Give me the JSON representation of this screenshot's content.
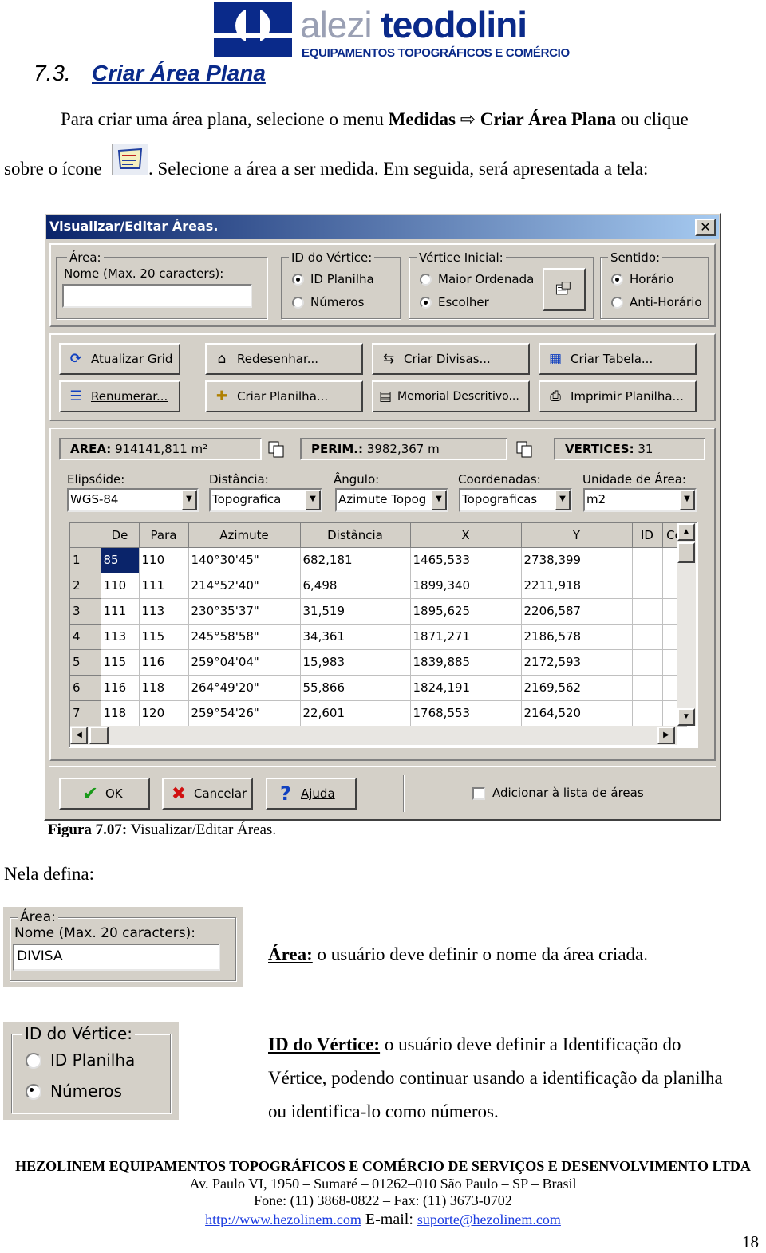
{
  "header": {
    "logo_word1": "alezi",
    "logo_word2": "teodolini",
    "logo_tagline": "EQUIPAMENTOS TOPOGRÁFICOS E COMÉRCIO"
  },
  "section": {
    "number": "7.3.",
    "title": "Criar Área Plana"
  },
  "intro": {
    "p1_a": "Para criar uma área plana, selecione o menu ",
    "p1_menu": "Medidas",
    "p1_arrow": "⇨",
    "p1_item": "Criar Área Plana",
    "p1_b": " ou clique",
    "p2_a": "sobre o ícone",
    "p2_b": ". Selecione a área a ser medida. Em seguida, será apresentada a tela:"
  },
  "dialog": {
    "title": "Visualizar/Editar Áreas.",
    "close": "✕",
    "area_group": {
      "legend": "Área:",
      "label": "Nome (Max. 20 caracters):",
      "value": ""
    },
    "id_group": {
      "legend": "ID do Vértice:",
      "opt1": "ID Planilha",
      "opt2": "Números"
    },
    "vertex_group": {
      "legend": "Vértice Inicial:",
      "opt1": "Maior Ordenada",
      "opt2": "Escolher"
    },
    "dir_group": {
      "legend": "Sentido:",
      "opt1": "Horário",
      "opt2": "Anti-Horário"
    },
    "buttons": {
      "refresh": "Atualizar Grid",
      "redraw": "Redesenhar...",
      "divisions": "Criar Divisas...",
      "table": "Criar Tabela...",
      "renumber": "Renumerar...",
      "sheet": "Criar Planilha...",
      "memorial": "Memorial Descritivo...",
      "print": "Imprimir Planilha..."
    },
    "info": {
      "area_label": "AREA:",
      "area_value": "914141,811 m²",
      "perim_label": "PERIM.:",
      "perim_value": "3982,367 m",
      "vert_label": "VERTICES:",
      "vert_value": "31"
    },
    "combos": {
      "ellipsoid_label": "Elipsóide:",
      "ellipsoid_value": "WGS-84",
      "distance_label": "Distância:",
      "distance_value": "Topografica",
      "angle_label": "Ângulo:",
      "angle_value": "Azimute Topog",
      "coords_label": "Coordenadas:",
      "coords_value": "Topograficas",
      "unit_label": "Unidade de Área:",
      "unit_value": "m2"
    },
    "grid": {
      "columns": [
        "",
        "De",
        "Para",
        "Azimute",
        "Distância",
        "X",
        "Y",
        "ID",
        "Co"
      ],
      "rows": [
        [
          "1",
          "85",
          "110",
          "140°30'45\"",
          "682,181",
          "1465,533",
          "2738,399",
          "",
          ""
        ],
        [
          "2",
          "110",
          "111",
          "214°52'40\"",
          "6,498",
          "1899,340",
          "2211,918",
          "",
          ""
        ],
        [
          "3",
          "111",
          "113",
          "230°35'37\"",
          "31,519",
          "1895,625",
          "2206,587",
          "",
          ""
        ],
        [
          "4",
          "113",
          "115",
          "245°58'58\"",
          "34,361",
          "1871,271",
          "2186,578",
          "",
          ""
        ],
        [
          "5",
          "115",
          "116",
          "259°04'04\"",
          "15,983",
          "1839,885",
          "2172,593",
          "",
          ""
        ],
        [
          "6",
          "116",
          "118",
          "264°49'20\"",
          "55,866",
          "1824,191",
          "2169,562",
          "",
          ""
        ],
        [
          "7",
          "118",
          "120",
          "259°54'26\"",
          "22,601",
          "1768,553",
          "2164,520",
          "",
          ""
        ]
      ]
    },
    "bottom": {
      "ok": "OK",
      "cancel": "Cancelar",
      "help": "Ajuda",
      "add_to_list": "Adicionar à lista de áreas"
    }
  },
  "caption": {
    "label": "Figura 7.07:",
    "text": " Visualizar/Editar Áreas."
  },
  "define_intro": "Nela defina:",
  "snippet_area": {
    "legend": "Área:",
    "label": "Nome (Max. 20 caracters):",
    "value": "DIVISA"
  },
  "desc_area": {
    "term": "Área:",
    "text": " o usuário deve definir o nome da área criada."
  },
  "snippet_id": {
    "legend": "ID do Vértice:",
    "opt1": "ID Planilha",
    "opt2": "Números"
  },
  "desc_id": {
    "term": "ID do Vértice:",
    "line1": " o usuário deve definir a Identificação do",
    "line2": "Vértice, podendo continuar usando a identificação da planilha",
    "line3": "ou identifica-lo como números."
  },
  "footer": {
    "company": "HEZOLINEM EQUIPAMENTOS TOPOGRÁFICOS E COMÉRCIO DE SERVIÇOS E DESENVOLVIMENTO LTDA",
    "address": "Av. Paulo VI, 1950 – Sumaré – 01262–010 São Paulo – SP – Brasil",
    "phone": "Fone: (11) 3868-0822 – Fax: (11) 3673-0702",
    "url": "http://www.hezolinem.com",
    "email_label": " E-mail: ",
    "email": "suporte@hezolinem.com",
    "page": "18"
  }
}
